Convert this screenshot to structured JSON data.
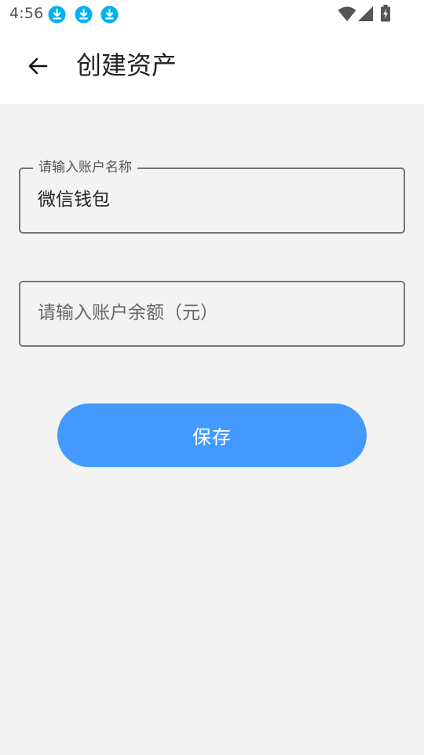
{
  "status_bar": {
    "time": "4:56",
    "notification_icons": [
      "download-icon",
      "download-icon",
      "download-icon"
    ],
    "system_icons": [
      "wifi-icon",
      "cell-signal-icon",
      "battery-charging-icon"
    ],
    "download_color": "#00b2f0"
  },
  "app_bar": {
    "back_icon": "arrow-left-icon",
    "title": "创建资产"
  },
  "form": {
    "account_name": {
      "label": "请输入账户名称",
      "value": "微信钱包"
    },
    "account_balance": {
      "placeholder": "请输入账户余额（元）",
      "value": ""
    }
  },
  "actions": {
    "save_label": "保存",
    "save_color": "#4499ff"
  }
}
